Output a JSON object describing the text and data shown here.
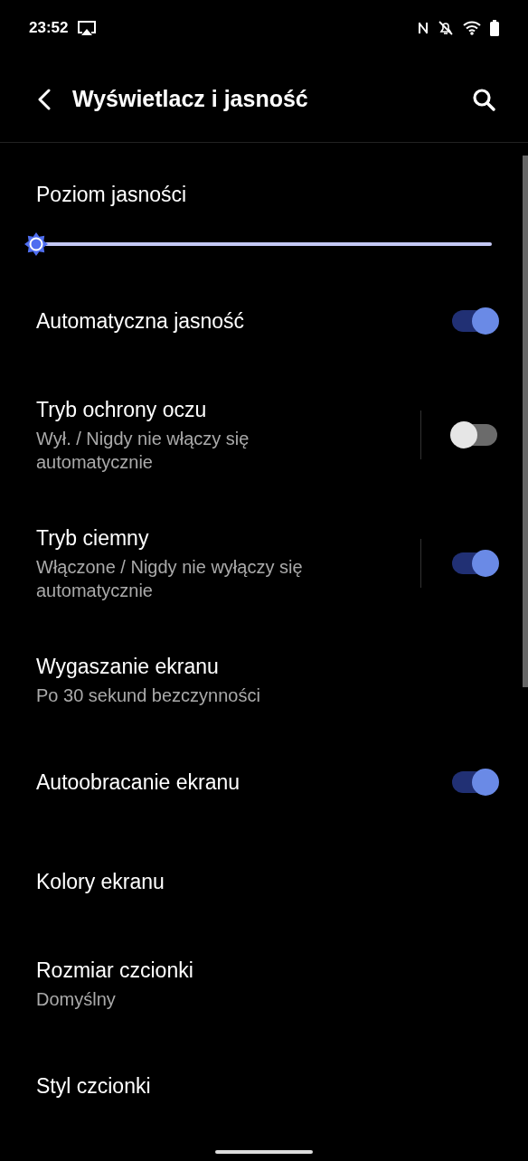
{
  "status_bar": {
    "time": "23:52"
  },
  "app_bar": {
    "title": "Wyświetlacz i jasność"
  },
  "brightness": {
    "title": "Poziom jasności",
    "level": 0.0
  },
  "items": [
    {
      "kind": "switch",
      "title": "Automatyczna jasność",
      "on": true
    },
    {
      "kind": "switch",
      "title": "Tryb ochrony oczu",
      "subtitle": "Wył. / Nigdy nie włączy się automatycznie",
      "on": false,
      "separated": true
    },
    {
      "kind": "switch",
      "title": "Tryb ciemny",
      "subtitle": "Włączone / Nigdy nie wyłączy się automatycznie",
      "on": true,
      "separated": true
    },
    {
      "kind": "text",
      "title": "Wygaszanie ekranu",
      "subtitle": "Po 30 sekund bezczynności"
    },
    {
      "kind": "switch",
      "title": "Autoobracanie ekranu",
      "on": true
    },
    {
      "kind": "text",
      "title": "Kolory ekranu"
    },
    {
      "kind": "text",
      "title": "Rozmiar czcionki",
      "subtitle": "Domyślny"
    },
    {
      "kind": "text",
      "title": "Styl czcionki"
    }
  ]
}
